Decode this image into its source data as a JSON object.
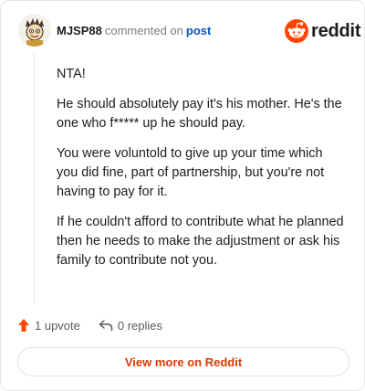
{
  "header": {
    "username": "MJSP88",
    "action_text": "commented on",
    "post_link": "post",
    "brand_name": "reddit"
  },
  "comment": {
    "paragraphs": [
      "NTA!",
      "He should absolutely pay it's his mother. He's the one who f***** up he should pay.",
      "You were voluntold to give up your time which you did fine, part of partnership, but you're not having to pay for it.",
      "If he couldn't afford to contribute what he planned then he needs to make the adjustment or ask his family to contribute not you."
    ]
  },
  "footer": {
    "upvotes": "1 upvote",
    "replies": "0 replies",
    "upvote_icon": "upvote-arrow-icon",
    "reply_icon": "reply-icon"
  },
  "cta": {
    "label": "View more on Reddit"
  },
  "colors": {
    "brand_orange": "#ff4500",
    "cta_text": "#d93a00",
    "link_blue": "#0a52c4"
  }
}
